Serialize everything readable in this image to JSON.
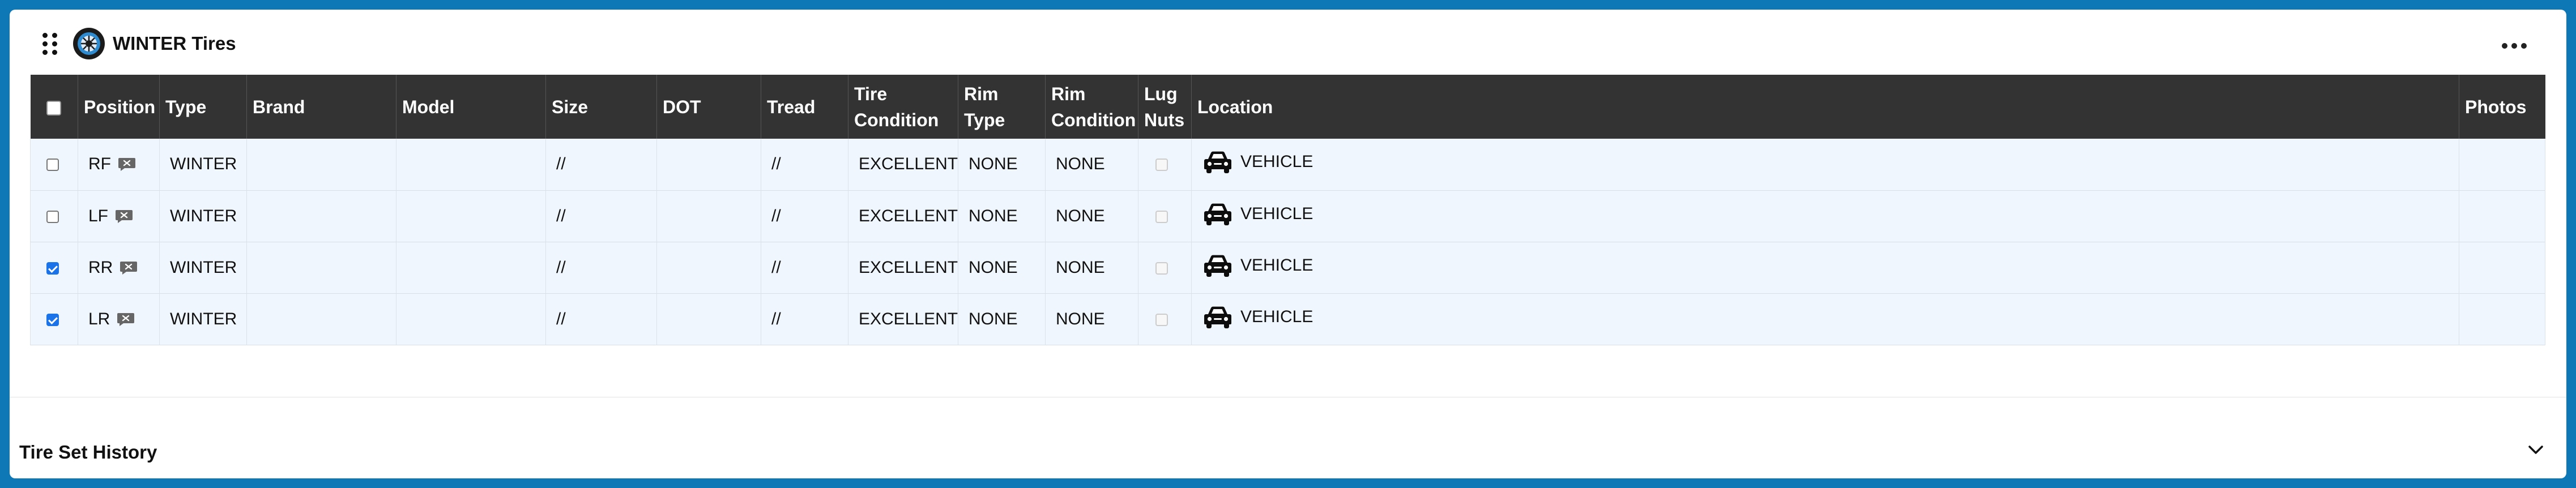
{
  "panel": {
    "title": "WINTER Tires",
    "icons": {
      "drag": "drag-handle-icon",
      "tire": "tire-icon",
      "more": "more-horizontal-icon"
    }
  },
  "table": {
    "columns": [
      "",
      "Position",
      "Type",
      "Brand",
      "Model",
      "Size",
      "DOT",
      "Tread",
      "Tire Condition",
      "Rim Type",
      "Rim Condition",
      "Lug Nuts",
      "Location",
      "Photos"
    ],
    "rows": [
      {
        "checked": false,
        "position": "RF",
        "type": "WINTER",
        "brand": "",
        "model": "",
        "size": "//",
        "dot": "",
        "tread": "//",
        "tire_condition": "EXCELLENT",
        "rim_type": "NONE",
        "rim_condition": "NONE",
        "lug_nuts": false,
        "location": "VEHICLE",
        "photos": ""
      },
      {
        "checked": false,
        "position": "LF",
        "type": "WINTER",
        "brand": "",
        "model": "",
        "size": "//",
        "dot": "",
        "tread": "//",
        "tire_condition": "EXCELLENT",
        "rim_type": "NONE",
        "rim_condition": "NONE",
        "lug_nuts": false,
        "location": "VEHICLE",
        "photos": ""
      },
      {
        "checked": true,
        "position": "RR",
        "type": "WINTER",
        "brand": "",
        "model": "",
        "size": "//",
        "dot": "",
        "tread": "//",
        "tire_condition": "EXCELLENT",
        "rim_type": "NONE",
        "rim_condition": "NONE",
        "lug_nuts": false,
        "location": "VEHICLE",
        "photos": ""
      },
      {
        "checked": true,
        "position": "LR",
        "type": "WINTER",
        "brand": "",
        "model": "",
        "size": "//",
        "dot": "",
        "tread": "//",
        "tire_condition": "EXCELLENT",
        "rim_type": "NONE",
        "rim_condition": "NONE",
        "lug_nuts": false,
        "location": "VEHICLE",
        "photos": ""
      }
    ]
  },
  "history": {
    "title": "Tire Set History",
    "icon": "chevron-down-icon"
  },
  "colors": {
    "frame": "#0e78b7",
    "table_header_bg": "#333333",
    "row_bg": "#eff6fd",
    "checkbox_checked": "#1a73e8"
  }
}
